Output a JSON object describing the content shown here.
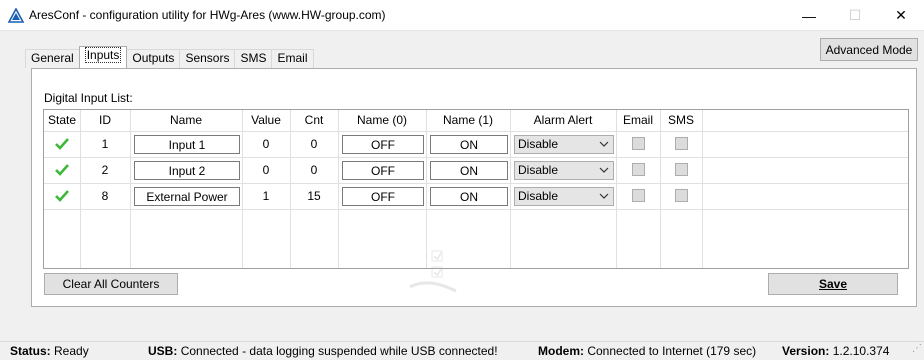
{
  "window": {
    "title": "AresConf - configuration utility for HWg-Ares (www.HW-group.com)",
    "minimize_glyph": "—",
    "maximize_glyph": "☐",
    "close_glyph": "✕"
  },
  "tabs": [
    {
      "label": "General",
      "active": false
    },
    {
      "label": "Inputs",
      "active": true
    },
    {
      "label": "Outputs",
      "active": false
    },
    {
      "label": "Sensors",
      "active": false
    },
    {
      "label": "SMS",
      "active": false
    },
    {
      "label": "Email",
      "active": false
    }
  ],
  "advanced_mode_label": "Advanced Mode",
  "digital_input_list_label": "Digital Input List:",
  "columns": [
    "State",
    "ID",
    "Name",
    "Value",
    "Cnt",
    "Name (0)",
    "Name (1)",
    "Alarm Alert",
    "Email",
    "SMS"
  ],
  "rows": [
    {
      "state_icon": "check-icon",
      "id": "1",
      "name": "Input 1",
      "value": "0",
      "cnt": "0",
      "name0": "OFF",
      "name1": "ON",
      "alarm_alert": "Disable",
      "email": false,
      "sms": false
    },
    {
      "state_icon": "check-icon",
      "id": "2",
      "name": "Input 2",
      "value": "0",
      "cnt": "0",
      "name0": "OFF",
      "name1": "ON",
      "alarm_alert": "Disable",
      "email": false,
      "sms": false
    },
    {
      "state_icon": "check-icon",
      "id": "8",
      "name": "External Power",
      "value": "1",
      "cnt": "15",
      "name0": "OFF",
      "name1": "ON",
      "alarm_alert": "Disable",
      "email": false,
      "sms": false
    }
  ],
  "buttons": {
    "clear_all_counters": "Clear All Counters",
    "save": "Save"
  },
  "status": {
    "status_label": "Status:",
    "status_value": "Ready",
    "usb_label": "USB:",
    "usb_value": "Connected - data logging suspended while USB connected!",
    "modem_label": "Modem:",
    "modem_value": "Connected to Internet (179 sec)",
    "version_label": "Version:",
    "version_value": "1.2.10.374"
  },
  "colors": {
    "check_green": "#3db83a",
    "window_bg": "#f0f0f0",
    "panel_bg": "#ffffff",
    "title_icon_blue": "#1a5fb4"
  }
}
